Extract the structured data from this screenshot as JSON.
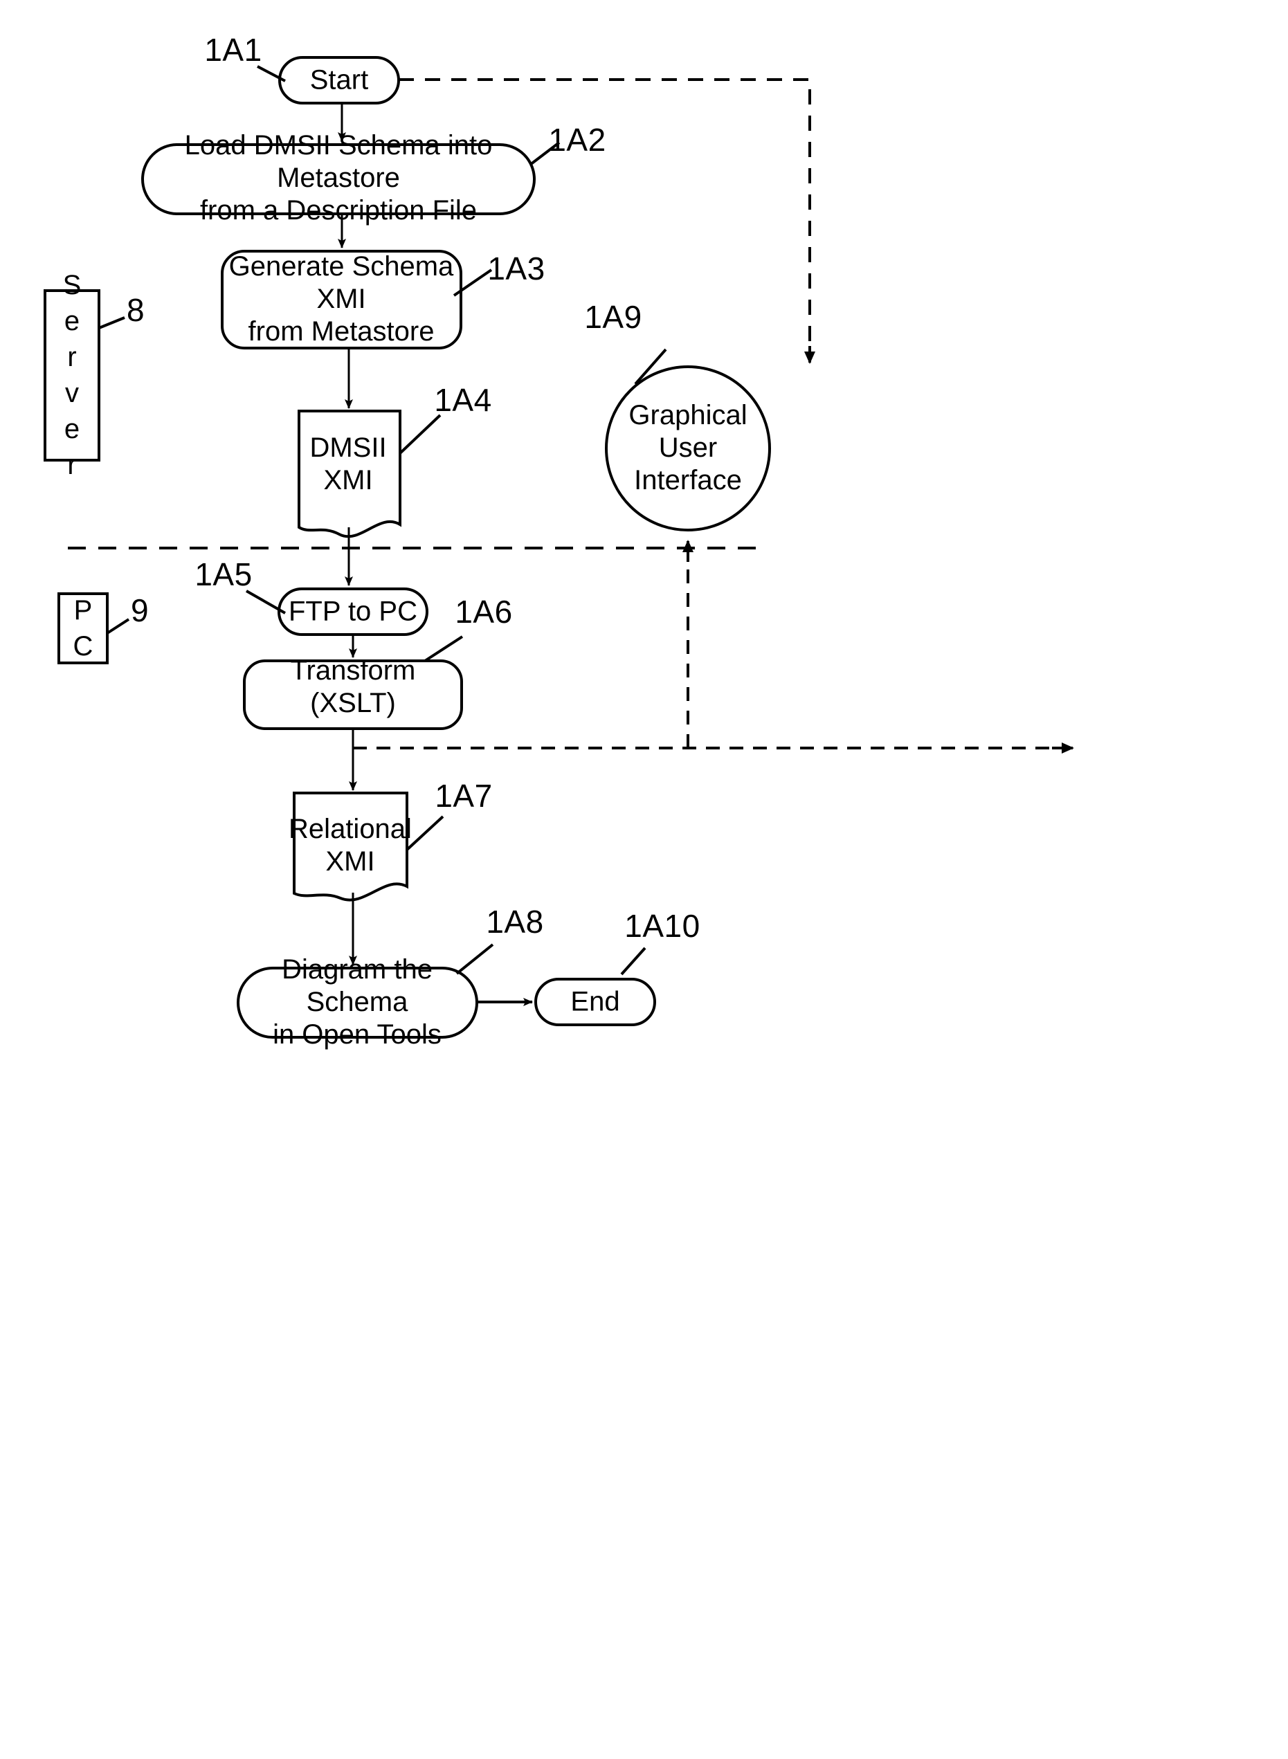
{
  "figure": {
    "type": "patent-flowchart",
    "background_color": "#ffffff",
    "line_color": "#000000"
  },
  "nodes": [
    {
      "id": "start",
      "shape": "pill",
      "label": "Start",
      "ref": "1A1",
      "ref_side": "left"
    },
    {
      "id": "load-schema",
      "shape": "pill",
      "label": "Load DMSII Schema into Metastore\nfrom a Description File",
      "ref": "1A2",
      "ref_side": "right"
    },
    {
      "id": "generate-xmi",
      "shape": "rounded-rect",
      "label": "Generate Schema XMI\nfrom Metastore",
      "ref": "1A3",
      "ref_side": "right"
    },
    {
      "id": "dmsii-xmi",
      "shape": "document",
      "label": "DMSII\nXMI",
      "ref": "1A4",
      "ref_side": "right"
    },
    {
      "id": "ftp-to-pc",
      "shape": "pill",
      "label": "FTP to PC",
      "ref": "1A5",
      "ref_side": "left"
    },
    {
      "id": "transform-xslt",
      "shape": "rounded-rect",
      "label": "Transform (XSLT)",
      "ref": "1A6",
      "ref_side": "right"
    },
    {
      "id": "relational-xmi",
      "shape": "document",
      "label": "Relational\nXMI",
      "ref": "1A7",
      "ref_side": "right"
    },
    {
      "id": "diagram-schema",
      "shape": "pill",
      "label": "Diagram the Schema\nin Open Tools",
      "ref": "1A8",
      "ref_side": "right"
    },
    {
      "id": "end",
      "shape": "pill",
      "label": "End",
      "ref": "1A10",
      "ref_side": "right"
    },
    {
      "id": "gui",
      "shape": "circle",
      "label": "Graphical\nUser\nInterface",
      "ref": "1A9",
      "ref_side": "left"
    }
  ],
  "side_boxes": [
    {
      "id": "server",
      "label": "S\ne\nr\nv\ne\nr",
      "ref": "8"
    },
    {
      "id": "pc",
      "label": "P\nC",
      "ref": "9"
    }
  ],
  "labels": {
    "start": "Start",
    "load_schema": "Load DMSII Schema into Metastore\nfrom a Description File",
    "generate_xmi": "Generate Schema XMI\nfrom Metastore",
    "dmsii_xmi": "DMSII\nXMI",
    "ftp_to_pc": "FTP to PC",
    "transform_xslt": "Transform (XSLT)",
    "relational_xmi": "Relational\nXMI",
    "diagram_schema": "Diagram the Schema\nin Open Tools",
    "end": "End",
    "gui": "Graphical\nUser\nInterface",
    "server": "S\ne\nr\nv\ne\nr",
    "pc": "P\nC"
  },
  "refs": {
    "start": "1A1",
    "load_schema": "1A2",
    "generate_xmi": "1A3",
    "dmsii_xmi": "1A4",
    "ftp_to_pc": "1A5",
    "transform_xslt": "1A6",
    "relational_xmi": "1A7",
    "diagram_schema": "1A8",
    "gui": "1A9",
    "end": "1A10",
    "server": "8",
    "pc": "9"
  },
  "connections": [
    {
      "from": "start",
      "to": "load-schema",
      "style": "solid",
      "arrow": true
    },
    {
      "from": "load-schema",
      "to": "generate-xmi",
      "style": "solid",
      "arrow": true
    },
    {
      "from": "generate-xmi",
      "to": "dmsii-xmi",
      "style": "solid",
      "arrow": true
    },
    {
      "from": "dmsii-xmi",
      "to": "ftp-to-pc",
      "style": "solid",
      "arrow": true
    },
    {
      "from": "ftp-to-pc",
      "to": "transform-xslt",
      "style": "solid",
      "arrow": true
    },
    {
      "from": "transform-xslt",
      "to": "relational-xmi",
      "style": "solid",
      "arrow": true
    },
    {
      "from": "relational-xmi",
      "to": "diagram-schema",
      "style": "solid",
      "arrow": true
    },
    {
      "from": "diagram-schema",
      "to": "end",
      "style": "solid",
      "arrow": true
    },
    {
      "from": "start",
      "to": "gui",
      "style": "dashed",
      "arrow": true
    },
    {
      "from": "transform-xslt",
      "to": "gui",
      "style": "dashed",
      "arrow": true
    },
    {
      "from": "gui",
      "to": "transform-xslt",
      "style": "dashed",
      "arrow": true
    }
  ],
  "separator": {
    "id": "server-pc-divider",
    "style": "dashed",
    "orientation": "horizontal"
  }
}
